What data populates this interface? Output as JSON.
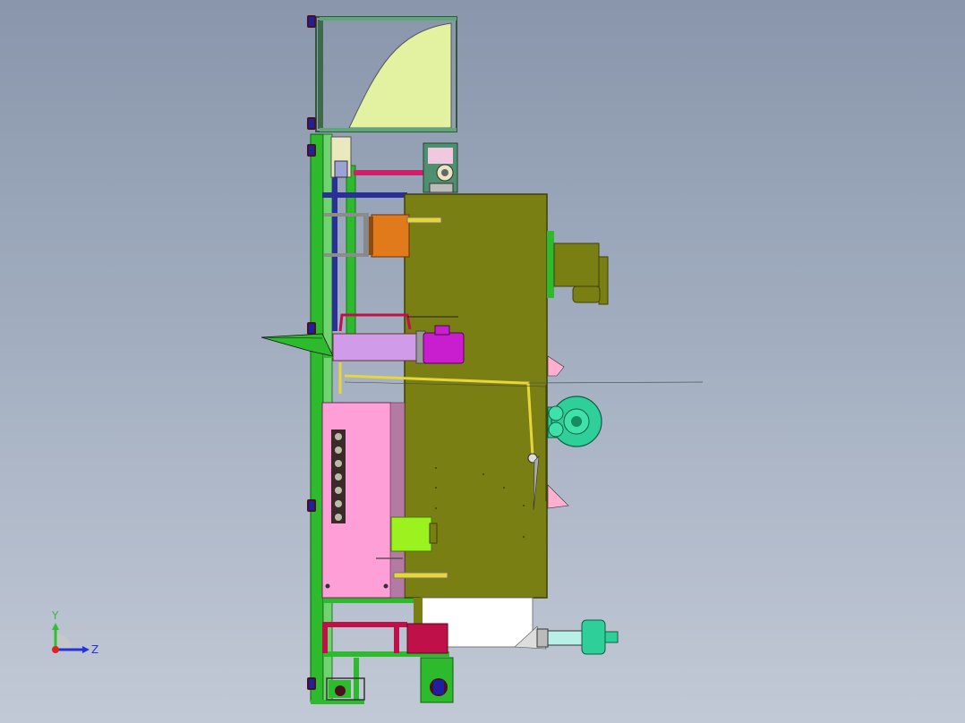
{
  "viewport": {
    "background_top": "#8996ab",
    "background_bottom": "#c2c9d6",
    "model_parts": [
      "hopper",
      "frame",
      "main-cabinet",
      "gear-motor",
      "heater-cylinder",
      "pink-control-box",
      "fan-blower",
      "discharge-chute",
      "outlet-motor",
      "caster-wheels"
    ]
  },
  "triad": {
    "y_label": "Y",
    "z_label": "Z",
    "colors": {
      "y": "#2fbf2f",
      "z": "#2233dd",
      "x": "#dd2222"
    }
  },
  "colors": {
    "cabinet": "#7a7f14",
    "hopper_fill": "#e3f2a0",
    "frame_green": "#2dbb2d",
    "pink_box": "#ff9fd8",
    "magenta": "#c81ed0",
    "orange": "#e07a1a",
    "teal": "#2fcf9a",
    "crimson": "#c0104a",
    "yellow_pipe": "#e6d63a",
    "lime": "#9cf21e"
  }
}
